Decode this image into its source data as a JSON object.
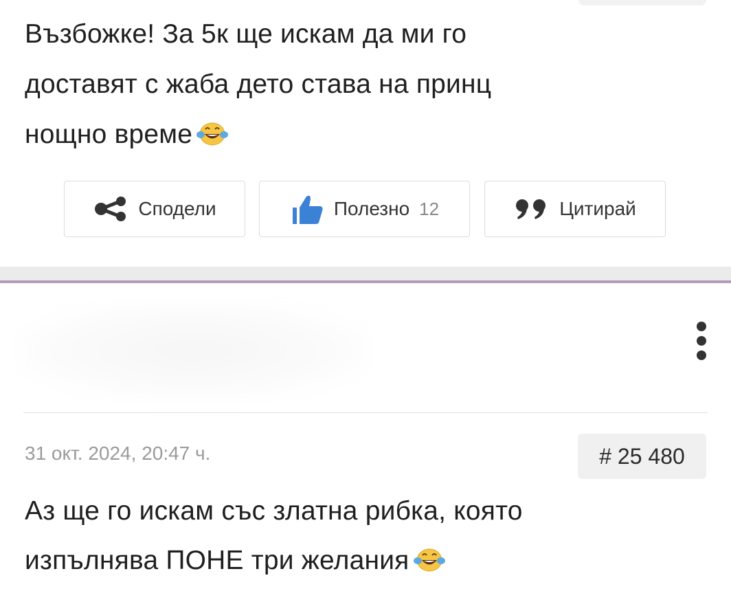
{
  "first_post": {
    "lines": [
      "Възбожке! За 5к ще искам да ми го",
      "доставят с жаба дето става на принц",
      "нощно време"
    ],
    "emoji": "tears-of-joy-emoji"
  },
  "actions": {
    "share_label": "Сподели",
    "useful_label": "Полезно",
    "useful_count": "12",
    "quote_label": "Цитирай"
  },
  "second_post": {
    "date": "31 окт. 2024, 20:47 ч.",
    "number": "# 25 480",
    "lines": [
      "Аз ще го искам със златна рибка, която",
      "изпълнява ПОНЕ три желания"
    ],
    "emoji": "tears-of-joy-emoji"
  },
  "colors": {
    "accent_separator": "#b59abf",
    "like_blue": "#3b82d6",
    "muted_text": "#9a9a9a"
  },
  "icons": {
    "share": "share-icon",
    "useful": "thumbs-up-icon",
    "quote": "quote-icon",
    "menu": "kebab-menu-icon"
  }
}
